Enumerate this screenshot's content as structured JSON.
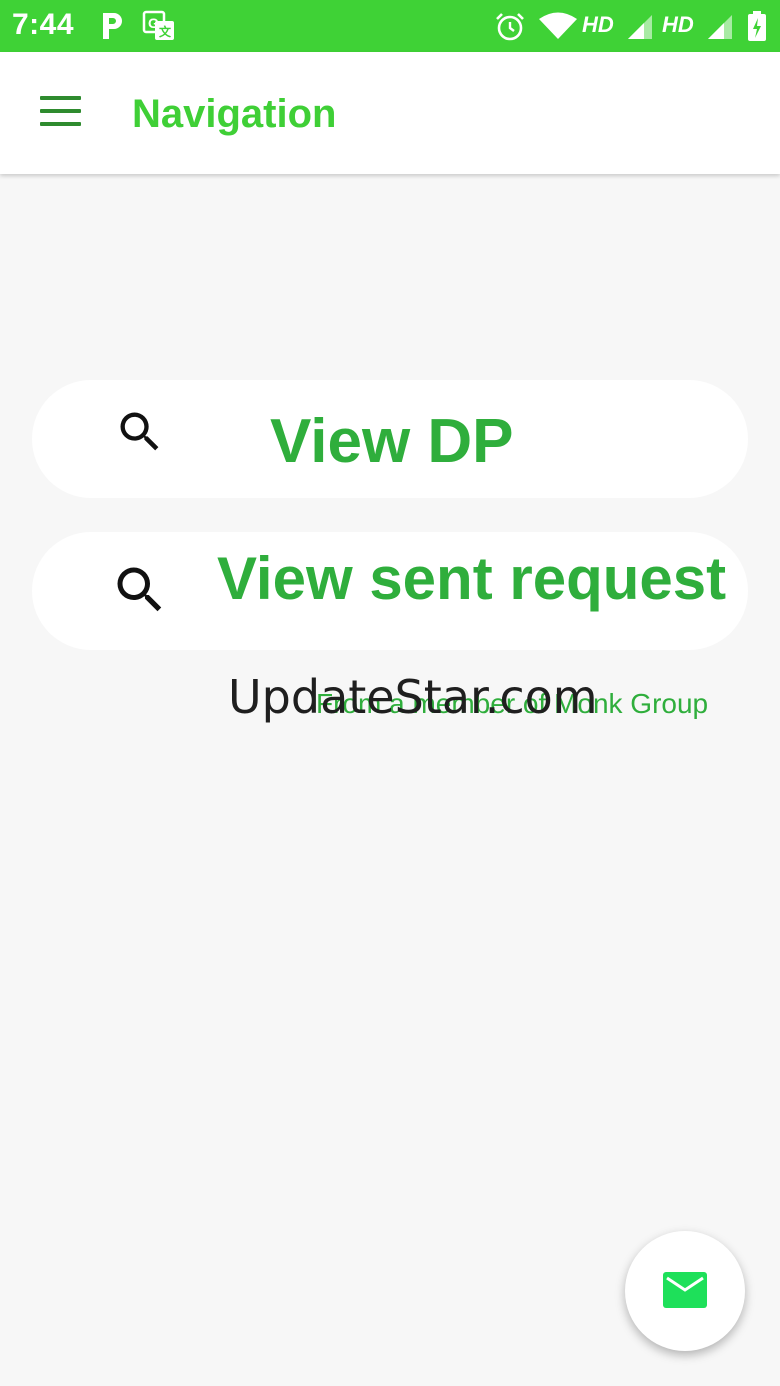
{
  "status_bar": {
    "time": "7:44",
    "hd_1": "HD",
    "hd_2": "HD",
    "icons": [
      "parking-icon",
      "translate-icon",
      "alarm-icon",
      "wifi-icon",
      "signal-icon",
      "signal-icon",
      "battery-icon"
    ]
  },
  "app_bar": {
    "title": "Navigation",
    "menu_icon": "menu-icon"
  },
  "actions": [
    {
      "label": "View DP",
      "icon": "search-icon"
    },
    {
      "label": "View sent request",
      "icon": "search-icon"
    }
  ],
  "credit_text": "From a member of Monk Group",
  "watermark": "UpdateStar.com",
  "fab": {
    "icon": "mail-icon"
  },
  "colors": {
    "status_bar": "#3fd236",
    "accent": "#3fcf36",
    "label_green": "#2fae3c",
    "menu_green": "#2e8b2e",
    "background": "#f7f7f7",
    "mail_green": "#1ee05a"
  }
}
